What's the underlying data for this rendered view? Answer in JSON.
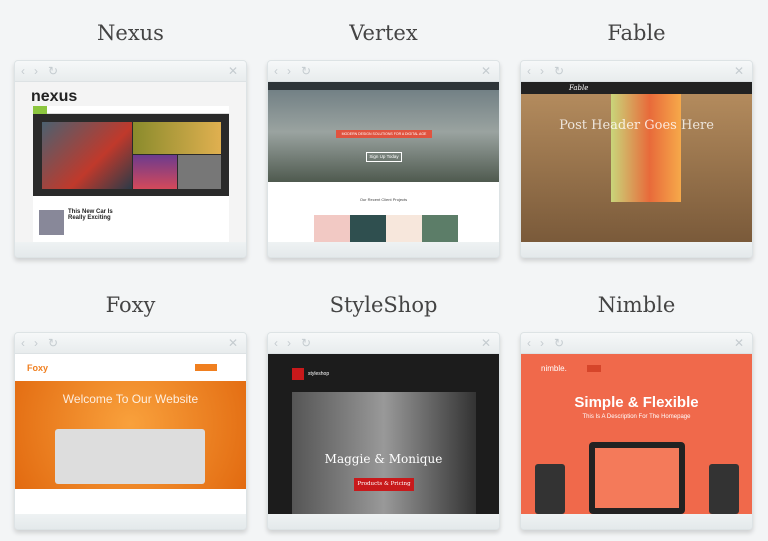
{
  "themes": [
    {
      "name": "Nexus",
      "logo": "nexus",
      "headline": "This New Car Is Really Exciting",
      "accent": "#8cc63f"
    },
    {
      "name": "Vertex",
      "banner": "MODERN DESIGN SOLUTIONS FOR A DIGITAL AGE",
      "button": "Sign Up Today",
      "section": "Our Recent Client Projects",
      "accent": "#e0533f"
    },
    {
      "name": "Fable",
      "logo": "Fable",
      "headline": "Post Header Goes Here",
      "accent": "#e8a248"
    },
    {
      "name": "Foxy",
      "logo": "Foxy",
      "headline": "Welcome To Our Website",
      "accent": "#f07f1f"
    },
    {
      "name": "StyleShop",
      "logo": "styleshop",
      "headline": "Maggie & Monique",
      "button": "Products & Pricing",
      "accent": "#c8191b"
    },
    {
      "name": "Nimble",
      "logo": "nimble.",
      "headline": "Simple & Flexible",
      "sub": "This Is A Description For The Homepage",
      "accent": "#f0694b"
    }
  ],
  "chrome": {
    "back": "‹",
    "forward": "›",
    "reload": "↻",
    "close": "✕"
  }
}
